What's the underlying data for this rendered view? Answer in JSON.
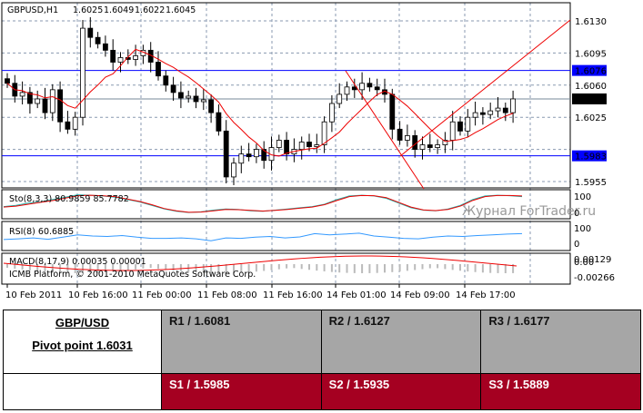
{
  "chart_data": {
    "type": "candlestick",
    "title": "GBPUSD,H1",
    "ohlc_header": [
      "1.6025",
      "1.6049",
      "1.6022",
      "1.6045"
    ],
    "closes": [
      1.6062,
      1.6048,
      1.6052,
      1.604,
      1.6045,
      1.603,
      1.6055,
      1.602,
      1.6012,
      1.6025,
      1.6122,
      1.6112,
      1.6105,
      1.6098,
      1.6085,
      1.609,
      1.6088,
      1.6092,
      1.6098,
      1.6085,
      1.607,
      1.606,
      1.6052,
      1.6046,
      1.6048,
      1.6042,
      1.6044,
      1.603,
      1.601,
      1.596,
      1.5975,
      1.5985,
      1.5982,
      1.599,
      1.5978,
      1.5992,
      1.6,
      1.5985,
      1.599,
      1.5998,
      1.5993,
      1.5995,
      1.602,
      1.604,
      1.605,
      1.6058,
      1.6055,
      1.6062,
      1.6058,
      1.6055,
      1.605,
      1.6012,
      1.6,
      1.6005,
      1.599,
      1.5995,
      1.5992,
      1.5995,
      1.6,
      1.602,
      1.601,
      1.6025,
      1.603,
      1.6028,
      1.6032,
      1.6035,
      1.603,
      1.6045
    ],
    "ylim": [
      1.5945,
      1.6145
    ],
    "y_ticks": [
      "1.6130",
      "1.6095",
      "1.6060",
      "1.6025",
      "1.5990",
      "1.5955"
    ],
    "hlines": [
      {
        "label": "1.6076",
        "value": 1.6076,
        "color": "#0000ff"
      },
      {
        "label": "1.5983",
        "value": 1.5983,
        "color": "#0000ff"
      }
    ],
    "current_price": {
      "label": "1.6045",
      "value": 1.6045
    },
    "x_labels": [
      "10 Feb 2011",
      "10 Feb 16:00",
      "11 Feb 00:00",
      "11 Feb 08:00",
      "11 Feb 16:00",
      "14 Feb 01:00",
      "14 Feb 09:00",
      "14 Feb 17:00"
    ],
    "indicators": {
      "sto": {
        "label": "Sto(8,3,3) 80.9859 85.7782",
        "ticks": [
          "100",
          "0"
        ],
        "main": [
          40,
          45,
          55,
          60,
          70,
          80,
          90,
          88,
          85,
          80,
          70,
          60,
          45,
          30,
          20,
          15,
          18,
          25,
          30,
          28,
          22,
          20,
          25,
          30,
          35,
          40,
          50,
          70,
          85,
          88,
          85,
          75,
          55,
          35,
          25,
          22,
          30,
          45,
          70,
          85,
          88,
          86,
          82
        ],
        "signal": [
          38,
          42,
          50,
          58,
          66,
          76,
          86,
          88,
          86,
          82,
          72,
          62,
          48,
          32,
          22,
          16,
          17,
          22,
          28,
          27,
          24,
          21,
          24,
          28,
          33,
          38,
          48,
          66,
          82,
          87,
          86,
          78,
          58,
          38,
          26,
          23,
          28,
          42,
          66,
          82,
          87,
          87,
          85
        ]
      },
      "rsi": {
        "label": "RSI(8) 60.6885",
        "ticks": [
          "100",
          "0"
        ],
        "values": [
          35,
          38,
          42,
          36,
          45,
          55,
          50,
          48,
          52,
          45,
          40,
          40,
          42,
          38,
          30,
          42,
          40,
          45,
          48,
          42,
          46,
          60,
          55,
          58,
          62,
          50,
          45,
          40,
          38,
          45,
          50,
          48,
          52,
          55,
          58,
          60
        ]
      },
      "macd": {
        "label": "MACD(8,17,9) 0.00035 0.00001",
        "ticks": [
          "0.00129",
          "0.00",
          "-0.00266"
        ]
      }
    }
  },
  "watermark": "Журнал ForTrader.ru",
  "copyright": "ICMB Platform, © 2001-2010 MetaQuotes Software Corp.",
  "pivot_table": {
    "pair": "GBP/USD",
    "pivot": "Pivot point 1.6031",
    "resistance": [
      "R1 / 1.6081",
      "R2 / 1.6127",
      "R3 / 1.6177"
    ],
    "support": [
      "S1 / 1.5985",
      "S2 / 1.5935",
      "S3 / 1.5889"
    ],
    "colors": {
      "resistance": "#a6a6a6",
      "support": "#a50021"
    }
  }
}
